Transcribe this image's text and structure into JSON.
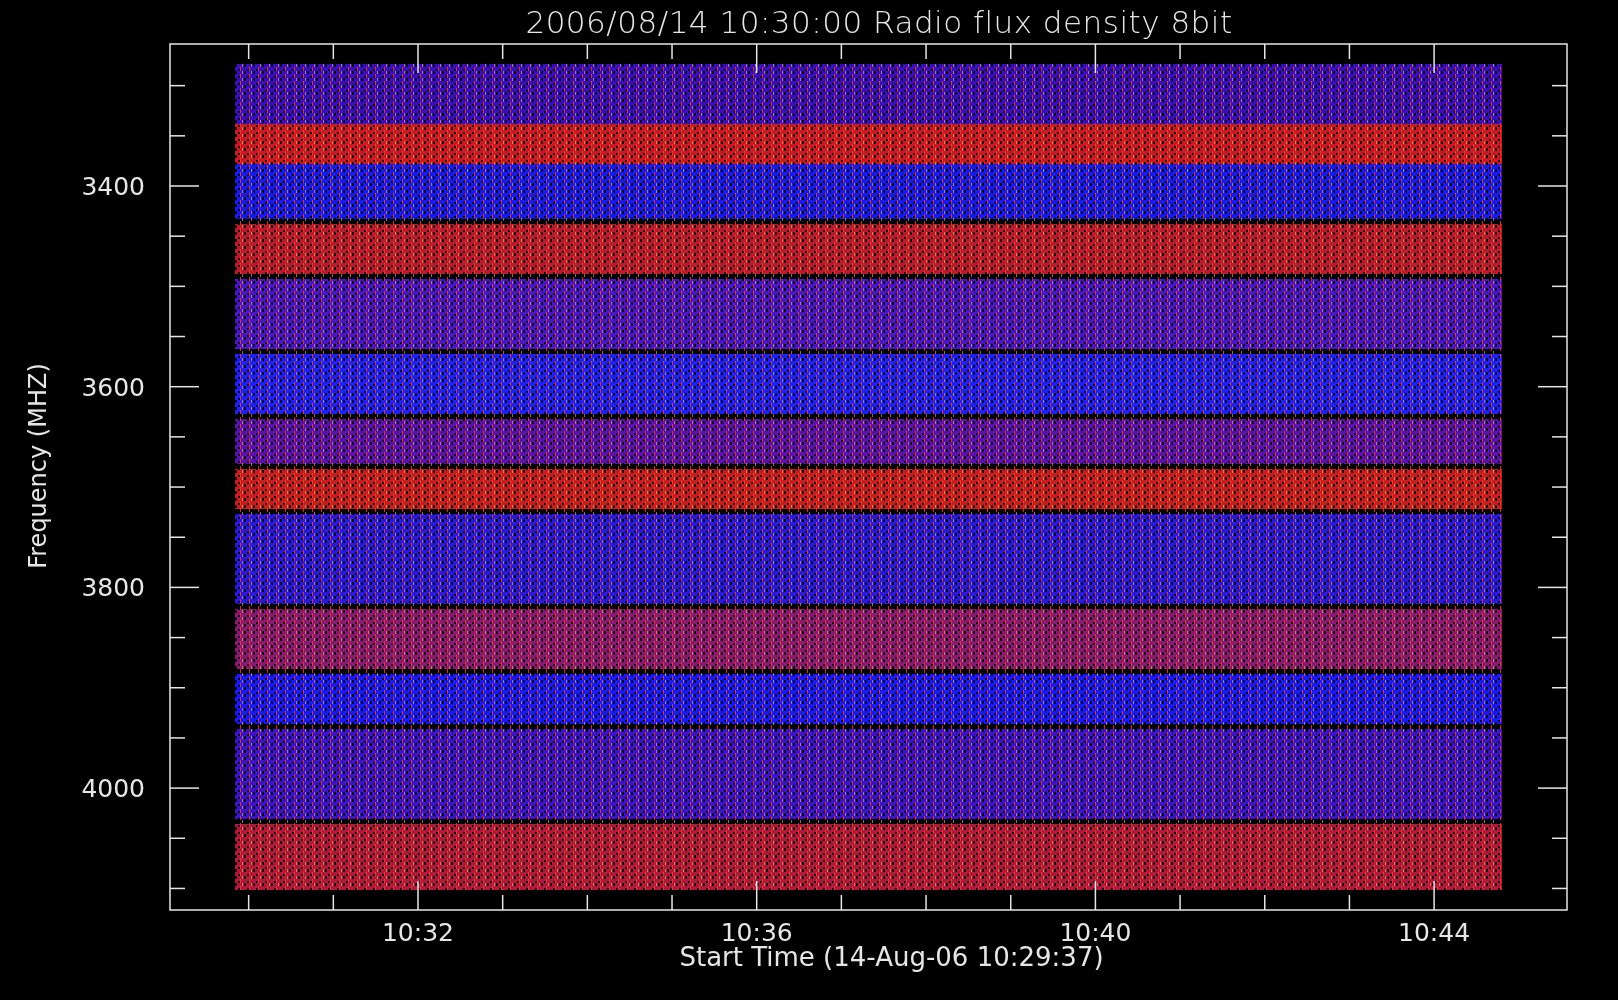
{
  "title": "2006/08/14 10:30:00 Radio flux density 8bit",
  "plot": {
    "ylabel": "Frequency (MHZ)",
    "xlabel": "Start Time (14-Aug-06 10:29:37)",
    "yticks": [
      "3400",
      "3600",
      "3800",
      "4000"
    ],
    "xticks": [
      "10:32",
      "10:36",
      "10:40",
      "10:44"
    ]
  }
}
